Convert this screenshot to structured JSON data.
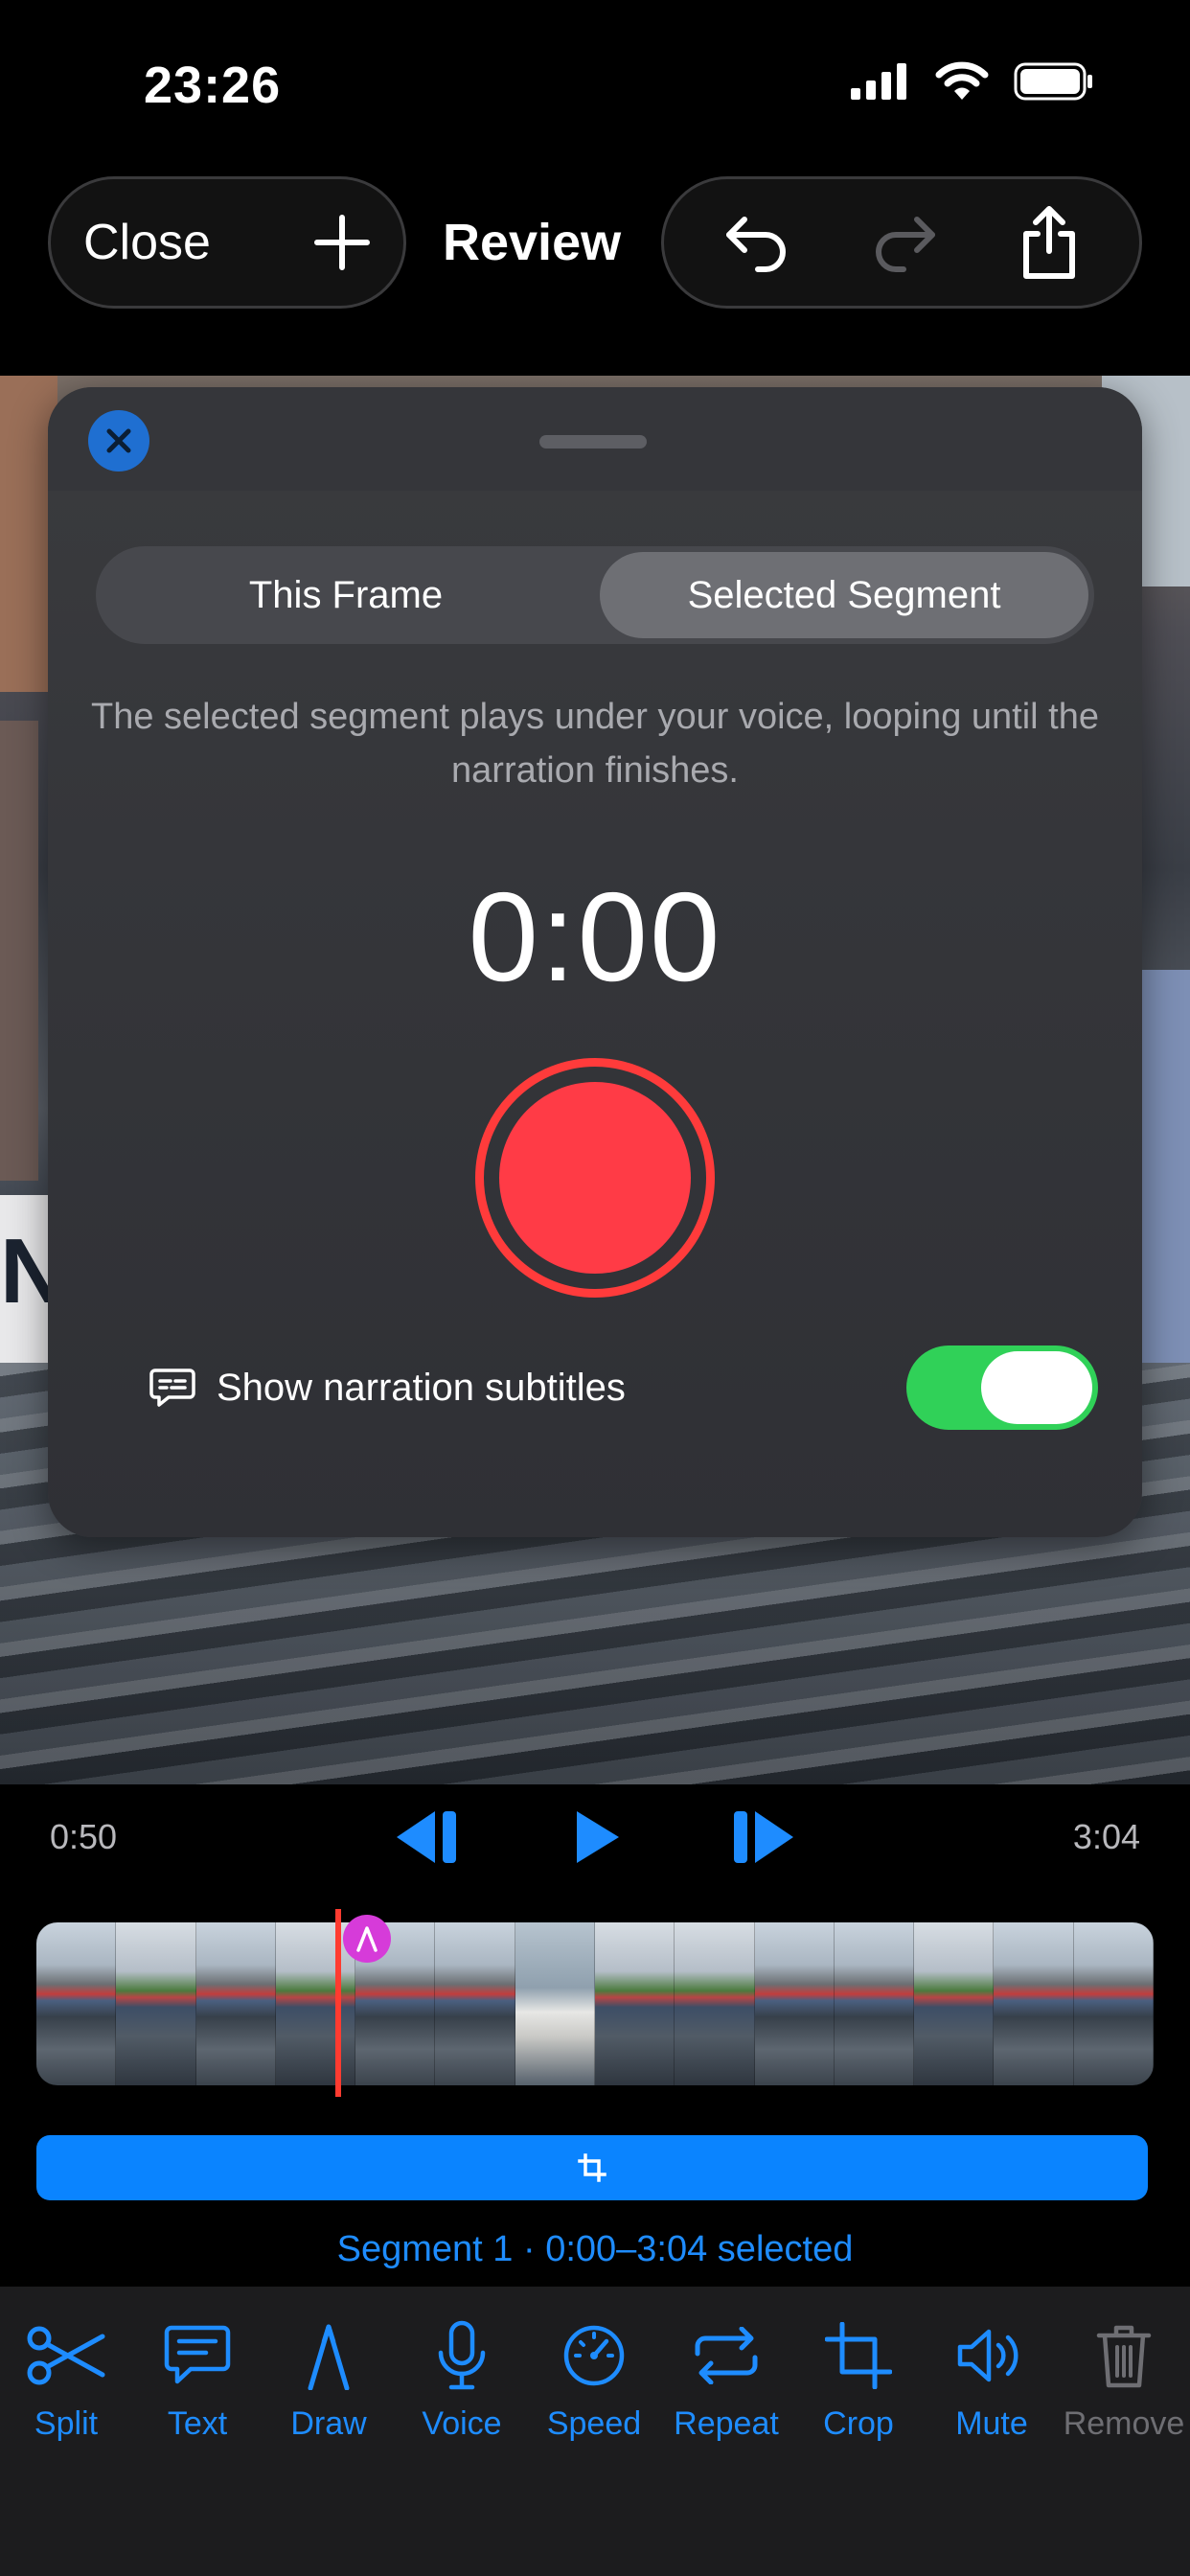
{
  "status_bar": {
    "time": "23:26"
  },
  "nav": {
    "close_label": "Close",
    "title": "Review"
  },
  "sheet": {
    "tabs": [
      {
        "label": "This Frame",
        "selected": false
      },
      {
        "label": "Selected Segment",
        "selected": true
      }
    ],
    "description": "The selected segment plays under your voice, looping until the narration finishes.",
    "timer": "0:00",
    "subtitles_label": "Show narration subtitles",
    "subtitles_enabled": true
  },
  "playback": {
    "start_time": "0:50",
    "end_time": "3:04"
  },
  "segment_caption": "Segment 1 · 0:00–3:04 selected",
  "toolbar": {
    "items": [
      {
        "label": "Split",
        "icon": "scissors-icon"
      },
      {
        "label": "Text",
        "icon": "text-bubble-icon"
      },
      {
        "label": "Draw",
        "icon": "pen-nib-icon"
      },
      {
        "label": "Voice",
        "icon": "microphone-icon"
      },
      {
        "label": "Speed",
        "icon": "speedometer-icon"
      },
      {
        "label": "Repeat",
        "icon": "repeat-icon"
      },
      {
        "label": "Crop",
        "icon": "crop-icon"
      },
      {
        "label": "Mute",
        "icon": "speaker-icon"
      },
      {
        "label": "Remove",
        "icon": "trash-icon"
      }
    ]
  },
  "colors": {
    "accent": "#0A84FF",
    "record": "#FF3B46",
    "toggle_on": "#30D158",
    "playhead": "#FF3B30"
  }
}
